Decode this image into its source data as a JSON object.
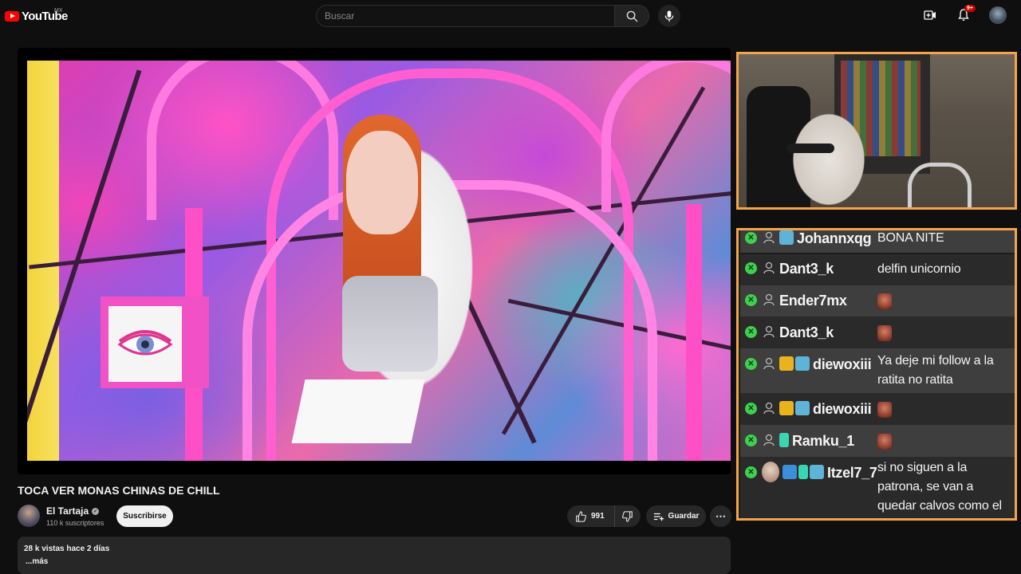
{
  "header": {
    "logo_text": "YouTube",
    "region": "MX",
    "search_placeholder": "Buscar",
    "notifications_count": "9+"
  },
  "video": {
    "title": "TOCA VER MONAS CHINAS DE CHILL",
    "channel_name": "El Tartaja",
    "subscribers": "110 k suscriptores",
    "subscribe_label": "Suscribirse",
    "likes": "991",
    "save_label": "Guardar",
    "views_date": "28 k vistas  hace 2 días",
    "more_label": "...más"
  },
  "chat": {
    "messages": [
      {
        "user": "Johannxqg",
        "text": "BONA NITE",
        "emote": false
      },
      {
        "user": "Dant3_k",
        "text": "delfin unicornio",
        "emote": false
      },
      {
        "user": "Ender7mx",
        "text": "",
        "emote": true
      },
      {
        "user": "Dant3_k",
        "text": "",
        "emote": true
      },
      {
        "user": "diewoxiii",
        "text": "Ya deje mi follow a la ratita no ratita",
        "emote": false
      },
      {
        "user": "diewoxiii",
        "text": "",
        "emote": true
      },
      {
        "user": "Ramku_1",
        "text": "",
        "emote": true
      },
      {
        "user": "Itzel7_7",
        "text": "si no siguen a la patrona, se van a quedar calvos como el vici",
        "emote": false
      }
    ]
  },
  "colors": {
    "accent": "#ff0000",
    "frame_border": "#f4a44a",
    "chat_badge": "#3fd04f"
  }
}
